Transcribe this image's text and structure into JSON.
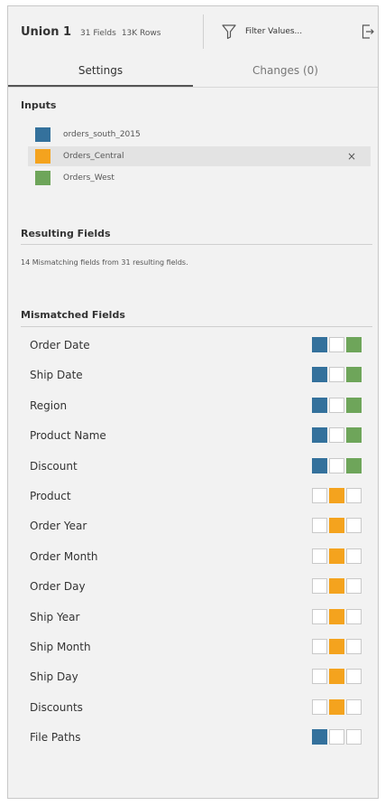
{
  "header": {
    "title": "Union 1",
    "fields_count": "31 Fields",
    "rows_count": "13K Rows",
    "filter_label": "Filter Values..."
  },
  "tabs": [
    {
      "label": "Settings",
      "active": true
    },
    {
      "label": "Changes (0)",
      "active": false
    }
  ],
  "inputs": {
    "title": "Inputs",
    "items": [
      {
        "label": "orders_south_2015",
        "color": "#34719c",
        "selected": false
      },
      {
        "label": "Orders_Central",
        "color": "#f4a31e",
        "selected": true,
        "remove": "×"
      },
      {
        "label": "Orders_West",
        "color": "#6ea55a",
        "selected": false
      }
    ]
  },
  "resulting": {
    "title": "Resulting Fields",
    "summary": "14 Mismatching fields from 31 resulting fields."
  },
  "mismatched": {
    "title": "Mismatched Fields",
    "fields": [
      {
        "label": "Order Date",
        "present": [
          true,
          false,
          true
        ]
      },
      {
        "label": "Ship Date",
        "present": [
          true,
          false,
          true
        ]
      },
      {
        "label": "Region",
        "present": [
          true,
          false,
          true
        ]
      },
      {
        "label": "Product Name",
        "present": [
          true,
          false,
          true
        ]
      },
      {
        "label": "Discount",
        "present": [
          true,
          false,
          true
        ]
      },
      {
        "label": "Product",
        "present": [
          false,
          true,
          false
        ]
      },
      {
        "label": "Order Year",
        "present": [
          false,
          true,
          false
        ]
      },
      {
        "label": "Order Month",
        "present": [
          false,
          true,
          false
        ]
      },
      {
        "label": "Order Day",
        "present": [
          false,
          true,
          false
        ]
      },
      {
        "label": "Ship Year",
        "present": [
          false,
          true,
          false
        ]
      },
      {
        "label": "Ship Month",
        "present": [
          false,
          true,
          false
        ]
      },
      {
        "label": "Ship Day",
        "present": [
          false,
          true,
          false
        ]
      },
      {
        "label": "Discounts",
        "present": [
          false,
          true,
          false
        ]
      },
      {
        "label": "File Paths",
        "present": [
          true,
          false,
          false
        ]
      }
    ]
  }
}
